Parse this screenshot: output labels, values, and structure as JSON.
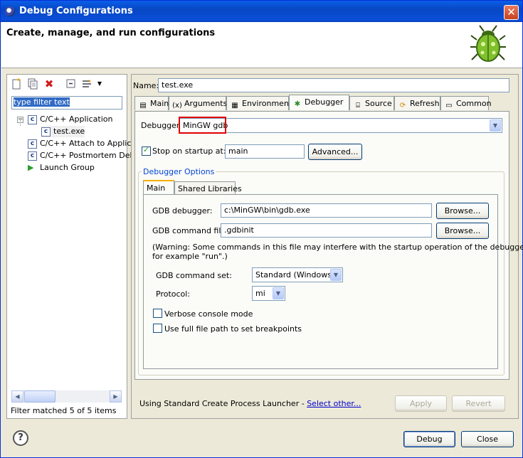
{
  "window": {
    "title": "Debug Configurations",
    "close_label": "✕"
  },
  "banner": {
    "title": "Create, manage, and run configurations"
  },
  "left": {
    "filter_placeholder": "type filter text",
    "tree": [
      {
        "label": "C/C++ Application"
      },
      {
        "label": "test.exe"
      },
      {
        "label": "C/C++ Attach to Applic"
      },
      {
        "label": "C/C++ Postmortem Deb"
      },
      {
        "label": "Launch Group"
      }
    ],
    "status": "Filter matched 5 of 5 items"
  },
  "config": {
    "name_label": "Name:",
    "name_value": "test.exe",
    "tabs": [
      "Main",
      "Arguments",
      "Environment",
      "Debugger",
      "Source",
      "Refresh",
      "Common"
    ],
    "debugger_label": "Debugger:",
    "debugger_value": "MinGW gdb",
    "stop_on_startup_label": "Stop on startup at:",
    "stop_on_startup_value": "main",
    "advanced_label": "Advanced...",
    "debugger_options_label": "Debugger Options",
    "subtabs": [
      "Main",
      "Shared Libraries"
    ],
    "gdb_debugger_label": "GDB debugger:",
    "gdb_debugger_value": "c:\\MinGW\\bin\\gdb.exe",
    "browse_label": "Browse...",
    "gdb_command_file_label": "GDB command file:",
    "gdb_command_file_value": ".gdbinit",
    "warning_line1": "(Warning: Some commands in this file may interfere with the startup operation of the debugger,",
    "warning_line2": "for example \"run\".)",
    "command_set_label": "GDB command set:",
    "command_set_value": "Standard (Windows)",
    "protocol_label": "Protocol:",
    "protocol_value": "mi",
    "verbose_label": "Verbose console mode",
    "fullpath_label": "Use full file path to set breakpoints",
    "launcher_text": "Using Standard Create Process Launcher - ",
    "select_other": "Select other...",
    "apply_label": "Apply",
    "revert_label": "Revert"
  },
  "footer": {
    "help_label": "?",
    "debug_label": "Debug",
    "close_label": "Close"
  }
}
